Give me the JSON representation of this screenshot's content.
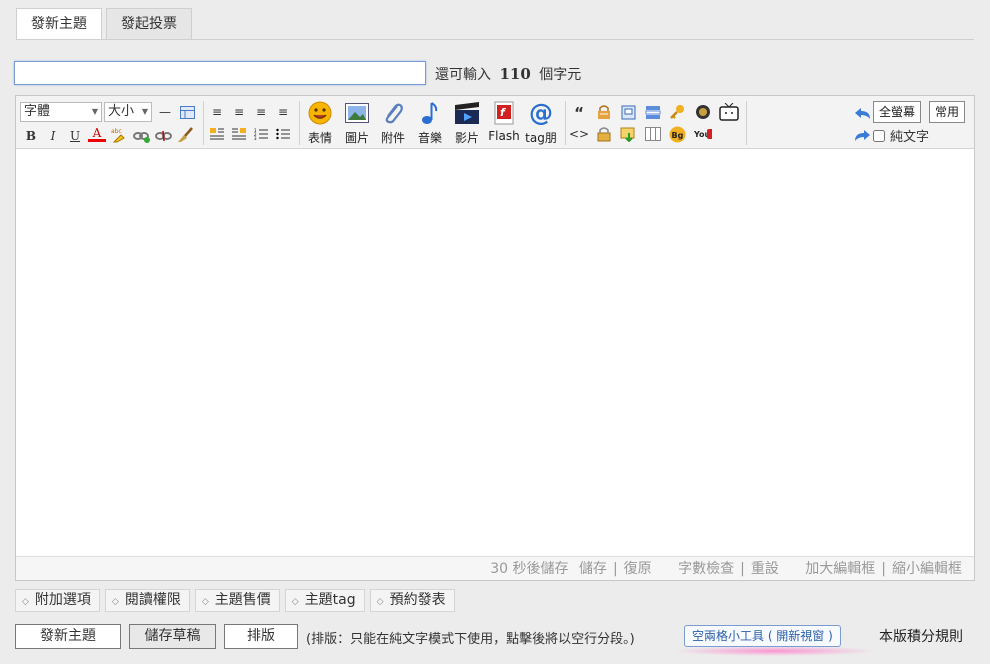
{
  "tabs": [
    "發新主題",
    "發起投票"
  ],
  "title_input": {
    "value": "",
    "placeholder": ""
  },
  "remain": {
    "prefix": "還可輸入",
    "count": "110",
    "suffix": "個字元"
  },
  "toolbar": {
    "font_select": "字體",
    "size_select": "大小",
    "format_labels": {
      "bold": "B",
      "italic": "I",
      "underline": "U",
      "color": "A"
    },
    "media": [
      {
        "label": "表情",
        "icon": "smiley-icon"
      },
      {
        "label": "圖片",
        "icon": "image-icon"
      },
      {
        "label": "附件",
        "icon": "paperclip-icon"
      },
      {
        "label": "音樂",
        "icon": "music-note-icon"
      },
      {
        "label": "影片",
        "icon": "film-icon"
      },
      {
        "label": "Flash",
        "icon": "flash-icon"
      },
      {
        "label": "tag朋",
        "icon": "at-icon"
      }
    ],
    "code_labels": {
      "quote": "“",
      "code": "<>",
      "bg": "Bg",
      "youtube": "You"
    },
    "fullscreen": "全螢幕",
    "common": "常用",
    "plain_text": "純文字"
  },
  "statusbar": {
    "autosave": "30 秒後儲存",
    "save": "儲存",
    "restore": "復原",
    "wordcount": "字數檢查",
    "reset": "重設",
    "enlarge": "加大編輯框",
    "shrink": "縮小編輯框"
  },
  "options": [
    "附加選項",
    "閱讀權限",
    "主題售價",
    "主題tag",
    "預約發表"
  ],
  "buttons": {
    "post": "發新主題",
    "draft": "儲存草稿",
    "layout": "排版"
  },
  "hint": "(排版：只能在純文字模式下使用，點擊後將以空行分段。)",
  "tool_link": "空兩格小工具 ( 開新視窗 )",
  "rules": "本版積分規則",
  "colors": {
    "accent": "#7b9bd3",
    "link": "#2b5fa8",
    "highlight": "#ff78c8"
  }
}
